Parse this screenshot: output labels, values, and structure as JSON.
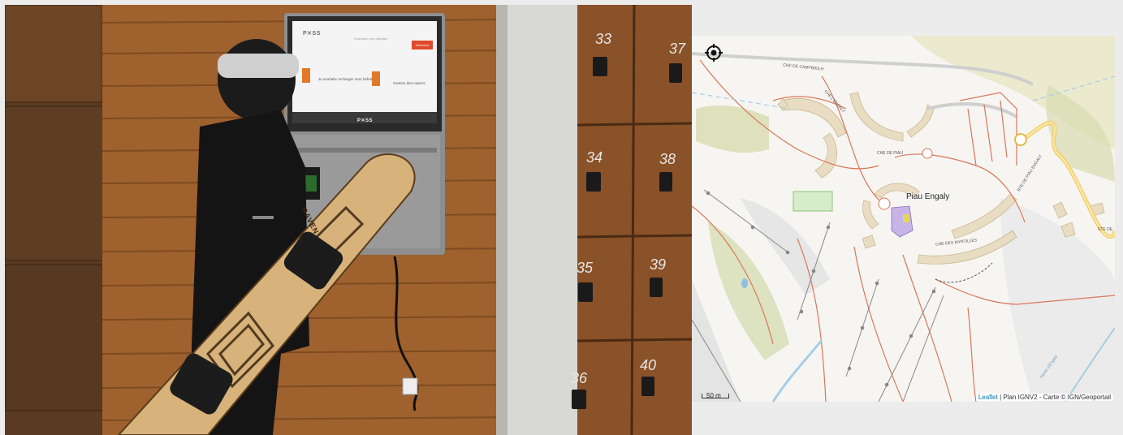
{
  "photo": {
    "kiosk": {
      "logo": "P✕SS",
      "subtitle": "Choisissez votre opération",
      "top_button": "Nouveau",
      "option_recharge": "Je souhaite recharger mon forfait",
      "option_casier": "Gestion des casiers",
      "footer_logo": "P✕SS"
    },
    "lockers": [
      "33",
      "37",
      "34",
      "38",
      "35",
      "39",
      "36",
      "40"
    ],
    "board_brand": "RAVEN"
  },
  "map": {
    "place_name": "Piau Engaly",
    "streets": {
      "campbieilh": "CHE DE CAMPBIEILH",
      "lengalu": "CHE L'ENGALY",
      "piau": "CHE DE PIAU",
      "myrtilles": "CHE DES MYRTILLES",
      "piau_engaly_route": "RTE DE PIAU ENGALY",
      "ste_de": "STE DE",
      "river": "Neste d'Engaly"
    },
    "scale_label": "50 m",
    "attribution": {
      "leaflet": "Leaflet",
      "rest": " | Plan IGNV2 - Carte © IGN/Geoportail"
    }
  }
}
